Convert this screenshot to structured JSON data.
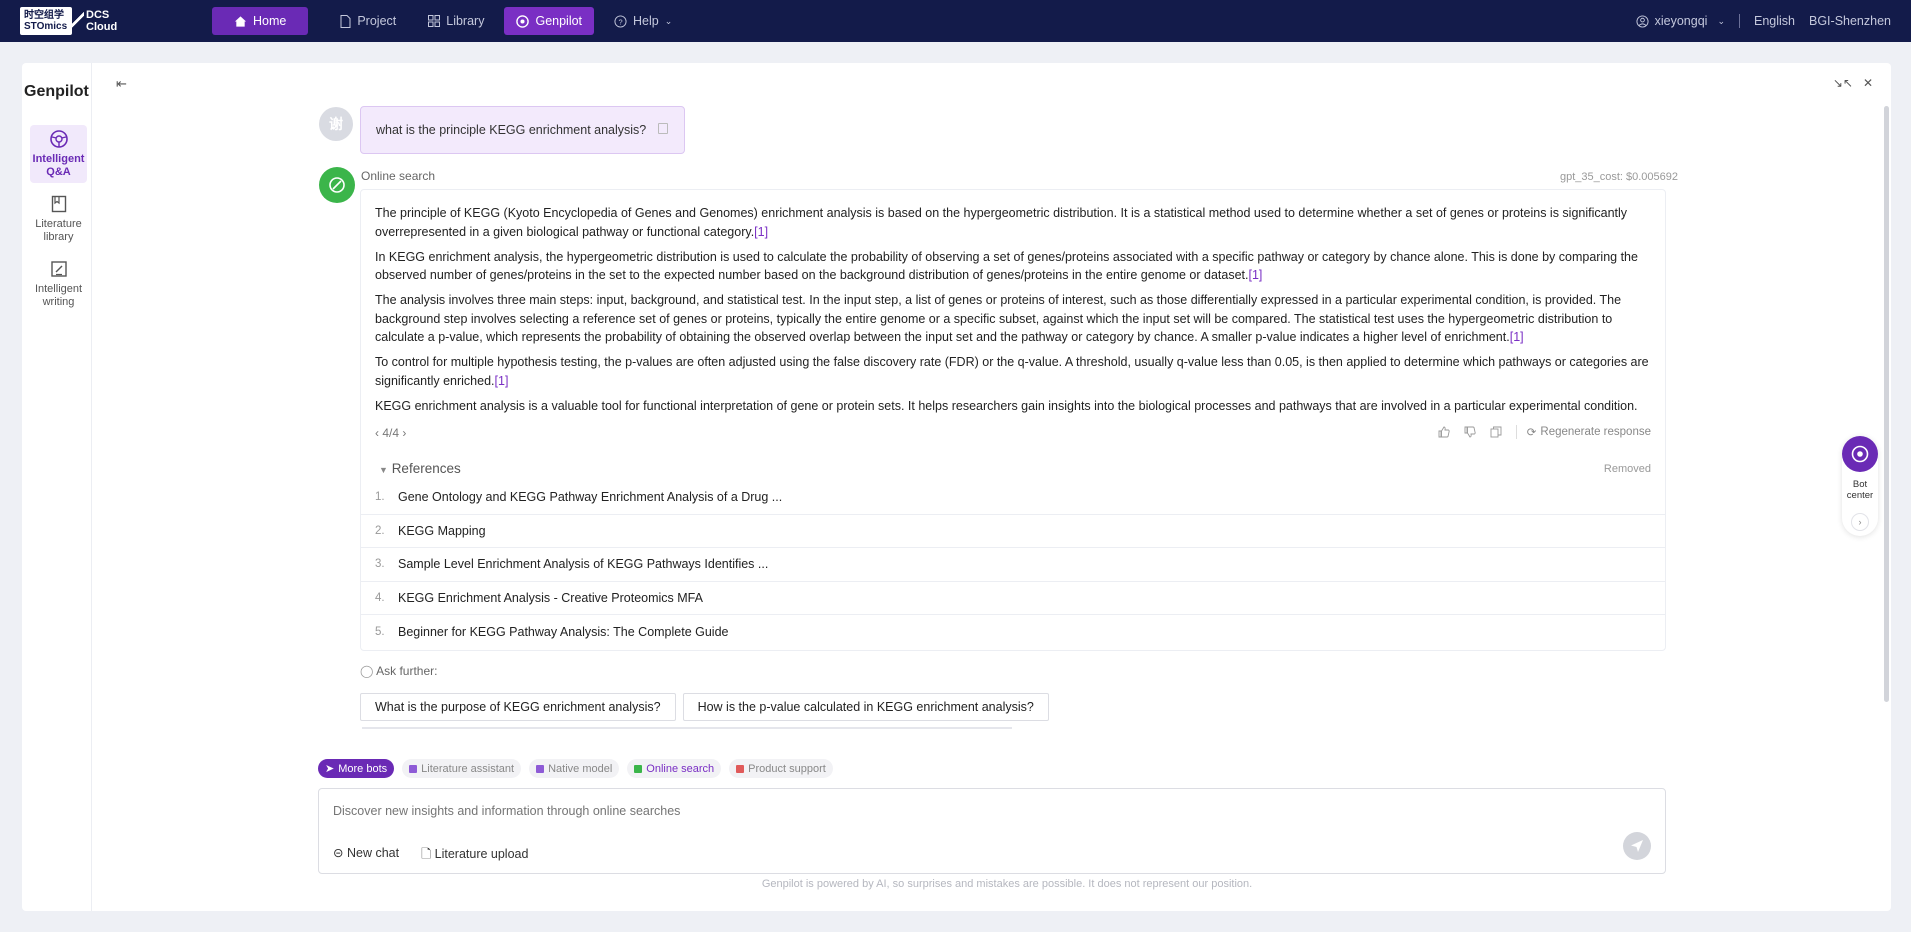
{
  "topbar": {
    "logo_line1": "时空组学",
    "logo_line2": "STOmics",
    "logo_text1": "DCS",
    "logo_text2": "Cloud",
    "nav": [
      {
        "label": "Home"
      },
      {
        "label": "Project"
      },
      {
        "label": "Library"
      },
      {
        "label": "Genpilot"
      },
      {
        "label": "Help"
      }
    ],
    "user": "xieyongqi",
    "language": "English",
    "region": "BGI-Shenzhen"
  },
  "sidebar": {
    "brand": "Genpilot",
    "items": [
      {
        "label": "Intelligent Q&A"
      },
      {
        "label": "Literature library"
      },
      {
        "label": "Intelligent writing"
      }
    ]
  },
  "chat": {
    "user_avatar": "谢",
    "question": "what is the principle KEGG enrichment analysis?",
    "bot_label": "Online search",
    "cost": "gpt_35_cost: $0.005692",
    "paragraphs": [
      "The principle of KEGG (Kyoto Encyclopedia of Genes and Genomes) enrichment analysis is based on the hypergeometric distribution. It is a statistical method used to determine whether a set of genes or proteins is significantly overrepresented in a given biological pathway or functional category.",
      "In KEGG enrichment analysis, the hypergeometric distribution is used to calculate the probability of observing a set of genes/proteins associated with a specific pathway or category by chance alone. This is done by comparing the observed number of genes/proteins in the set to the expected number based on the background distribution of genes/proteins in the entire genome or dataset.",
      "The analysis involves three main steps: input, background, and statistical test. In the input step, a list of genes or proteins of interest, such as those differentially expressed in a particular experimental condition, is provided. The background step involves selecting a reference set of genes or proteins, typically the entire genome or a specific subset, against which the input set will be compared. The statistical test uses the hypergeometric distribution to calculate a p-value, which represents the probability of obtaining the observed overlap between the input set and the pathway or category by chance. A smaller p-value indicates a higher level of enrichment.",
      "To control for multiple hypothesis testing, the p-values are often adjusted using the false discovery rate (FDR) or the q-value. A threshold, usually q-value less than 0.05, is then applied to determine which pathways or categories are significantly enriched.",
      "KEGG enrichment analysis is a valuable tool for functional interpretation of gene or protein sets. It helps researchers gain insights into the biological processes and pathways that are involved in a particular experimental condition."
    ],
    "citation": "[1]",
    "pager": "4/4",
    "regenerate": "Regenerate response",
    "references_title": "References",
    "references_removed": "Removed",
    "references": [
      {
        "num": "1.",
        "title": "Gene Ontology and KEGG Pathway Enrichment Analysis of a Drug ..."
      },
      {
        "num": "2.",
        "title": "KEGG Mapping"
      },
      {
        "num": "3.",
        "title": "Sample Level Enrichment Analysis of KEGG Pathways Identifies ..."
      },
      {
        "num": "4.",
        "title": "KEGG Enrichment Analysis - Creative Proteomics MFA"
      },
      {
        "num": "5.",
        "title": "Beginner for KEGG Pathway Analysis: The Complete Guide"
      }
    ],
    "ask_further": "Ask further:",
    "suggestions": [
      "What is the purpose of KEGG enrichment analysis?",
      "How is the p-value calculated in KEGG enrichment analysis?"
    ]
  },
  "bots": [
    {
      "label": "More bots"
    },
    {
      "label": "Literature assistant",
      "color": "#8e5bd6"
    },
    {
      "label": "Native model",
      "color": "#8e5bd6"
    },
    {
      "label": "Online search",
      "color": "#3bb54a"
    },
    {
      "label": "Product support",
      "color": "#e05a5a"
    }
  ],
  "input": {
    "placeholder": "Discover new insights and information through online searches",
    "new_chat": "New chat",
    "upload": "Literature upload"
  },
  "footer": "Genpilot is powered by AI, so surprises and mistakes are possible. It does not represent our position.",
  "bot_center": {
    "label": "Bot center"
  },
  "colors": {
    "accent": "#7a2fc4",
    "nav_bg": "#131b4a",
    "bot_green": "#3bb54a"
  }
}
